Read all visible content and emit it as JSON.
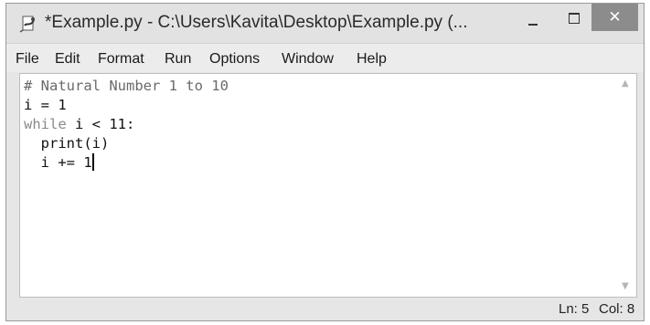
{
  "window": {
    "title": "*Example.py - C:\\Users\\Kavita\\Desktop\\Example.py (...",
    "close_label": "✕"
  },
  "menu": {
    "file": "File",
    "edit": "Edit",
    "format": "Format",
    "run": "Run",
    "options": "Options",
    "window": "Window",
    "help": "Help"
  },
  "editor": {
    "lines": [
      {
        "parts": [
          {
            "text": "# Natural Number 1 to 10",
            "style": "comment"
          }
        ]
      },
      {
        "parts": [
          {
            "text": "i = 1",
            "style": "normal"
          }
        ]
      },
      {
        "parts": [
          {
            "text": "while",
            "style": "keyword"
          },
          {
            "text": " i < 11:",
            "style": "normal"
          }
        ]
      },
      {
        "parts": [
          {
            "text": "  print(i)",
            "style": "normal"
          }
        ]
      },
      {
        "parts": [
          {
            "text": "  i += 1",
            "style": "normal"
          }
        ]
      }
    ]
  },
  "status": {
    "line": "Ln: 5",
    "col": "Col: 8"
  },
  "colors": {
    "comment": "#6a6a6a",
    "keyword": "#8a8a8a",
    "close_button": "#8c8c8c"
  },
  "icons": {
    "app": "python-idle-icon",
    "minimize": "minimize-icon",
    "maximize": "maximize-icon",
    "close": "close-icon"
  }
}
